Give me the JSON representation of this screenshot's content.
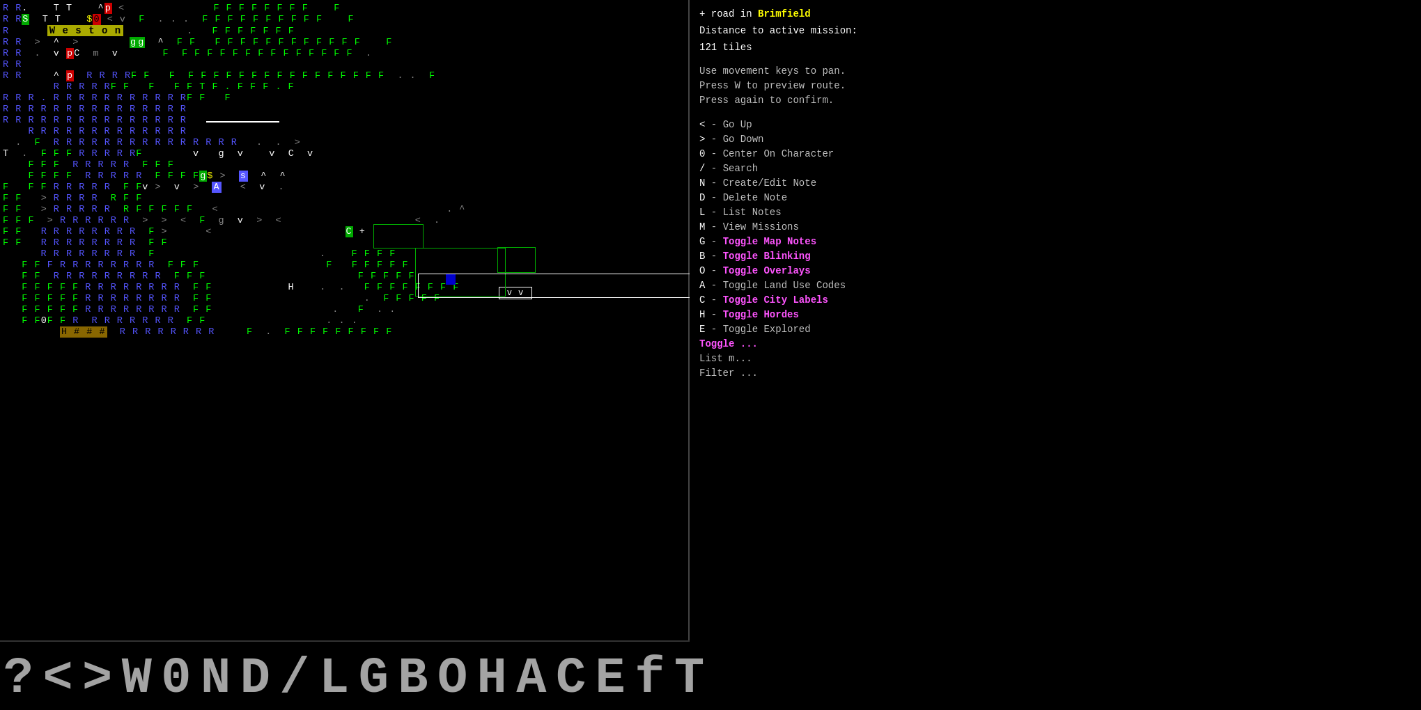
{
  "sidebar": {
    "location_prefix": "+ road in ",
    "location_city": "Brimfield",
    "distance_label": "Distance to active mission:",
    "distance_value": "121 tiles",
    "hints": [
      "Use movement keys to pan.",
      "Press W to preview route.",
      "Press again to confirm."
    ],
    "keys": [
      {
        "key": "<",
        "separator": " - ",
        "action": "Go Up",
        "pink": false
      },
      {
        "key": ">",
        "separator": " - ",
        "action": "Go Down",
        "pink": false
      },
      {
        "key": "0",
        "separator": " - ",
        "action": "Center On Character",
        "pink": false
      },
      {
        "key": "/",
        "separator": " - ",
        "action": "Search",
        "pink": false
      },
      {
        "key": "N",
        "separator": " - ",
        "action": "Create/Edit Note",
        "pink": false
      },
      {
        "key": "D",
        "separator": " - ",
        "action": "Delete Note",
        "pink": false
      },
      {
        "key": "L",
        "separator": " - ",
        "action": "List Notes",
        "pink": false
      },
      {
        "key": "M",
        "separator": " - ",
        "action": "View Missions",
        "pink": false
      },
      {
        "key": "G",
        "separator": " - ",
        "action": "Toggle Map Notes",
        "pink": true
      },
      {
        "key": "B",
        "separator": " - ",
        "action": "Toggle Blinking",
        "pink": true
      },
      {
        "key": "O",
        "separator": " - ",
        "action": "Toggle Overlays",
        "pink": true
      },
      {
        "key": "A",
        "separator": " - ",
        "action": "Toggle Land Use Codes",
        "pink": false
      },
      {
        "key": "C",
        "separator": " - ",
        "action": "Toggle City Labels",
        "pink": true
      },
      {
        "key": "H",
        "separator": " - ",
        "action": "Toggle Hordes",
        "pink": true
      },
      {
        "key": "E",
        "separator": " - ",
        "action": "Toggle Explored",
        "pink": false
      }
    ],
    "more_text1": "Toggle",
    "more_text2": "List m",
    "more_text3": "Filter"
  },
  "bottom_bar": {
    "chars": [
      "?",
      "<",
      ">",
      "W",
      "0",
      "N",
      "D",
      "/",
      "L",
      "G",
      "B",
      "O",
      "H",
      "A",
      "C",
      "E",
      "f",
      "T"
    ]
  },
  "map": {
    "weston_label": "W e s t o n",
    "city": "Brimfield"
  }
}
